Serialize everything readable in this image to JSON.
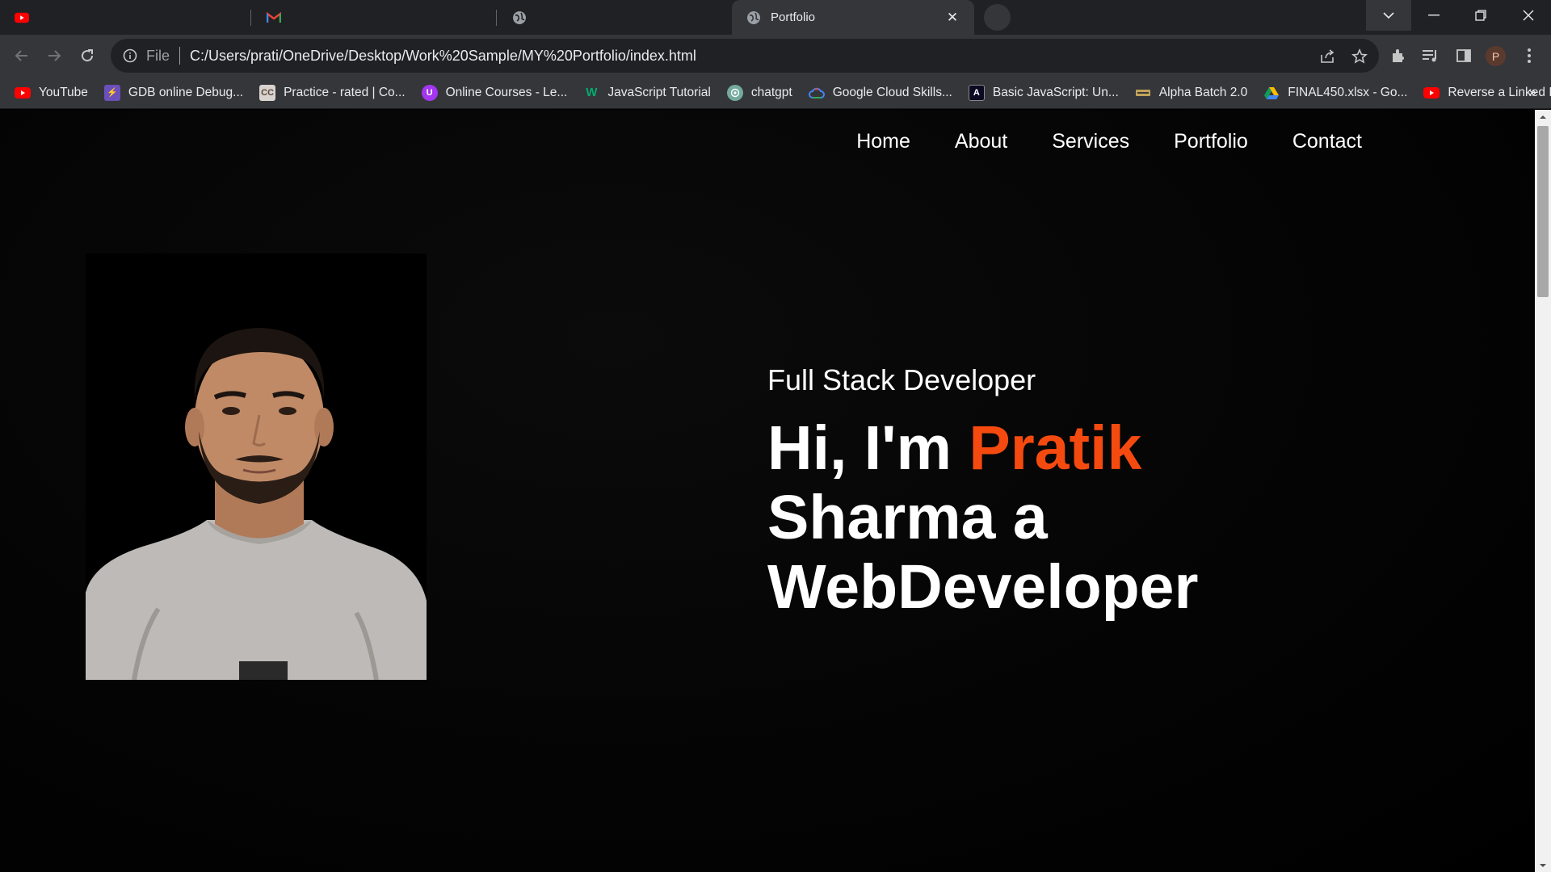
{
  "browser": {
    "tabs": [
      {
        "title": "",
        "icon": "youtube-icon"
      },
      {
        "title": "",
        "icon": "gmail-icon"
      },
      {
        "title": "",
        "icon": "globe-icon"
      },
      {
        "title": "Portfolio",
        "icon": "globe-icon",
        "active": true
      }
    ],
    "address": {
      "scheme_label": "File",
      "url": "C:/Users/prati/OneDrive/Desktop/Work%20Sample/MY%20Portfolio/index.html"
    },
    "profile_initial": "P",
    "bookmarks": [
      {
        "label": "YouTube",
        "icon": "youtube-icon",
        "color": "#ff0000"
      },
      {
        "label": "GDB online Debug...",
        "icon": "bolt-icon",
        "color": "#6b4fbb"
      },
      {
        "label": "Practice - rated | Co...",
        "icon": "codechef-icon",
        "color": "#5b4638"
      },
      {
        "label": "Online Courses - Le...",
        "icon": "udemy-icon",
        "color": "#a435f0"
      },
      {
        "label": "JavaScript Tutorial",
        "icon": "w3-icon",
        "color": "#04aa6d"
      },
      {
        "label": "chatgpt",
        "icon": "openai-icon",
        "color": "#74aa9c"
      },
      {
        "label": "Google Cloud Skills...",
        "icon": "gcloud-icon",
        "color": "#4285f4"
      },
      {
        "label": "Basic JavaScript: Un...",
        "icon": "fcc-icon",
        "color": "#0a0a23"
      },
      {
        "label": "Alpha Batch 2.0",
        "icon": "apna-icon",
        "color": "#c2a35a"
      },
      {
        "label": "FINAL450.xlsx - Go...",
        "icon": "gdrive-icon",
        "color": "#fbbc04"
      },
      {
        "label": "Reverse a Linked Lis...",
        "icon": "youtube-icon",
        "color": "#ff0000"
      }
    ],
    "bookmarks_more": "»"
  },
  "site": {
    "nav": [
      "Home",
      "About",
      "Services",
      "Portfolio",
      "Contact"
    ],
    "hero": {
      "subtitle": "Full Stack Developer",
      "greeting": "Hi, I'm ",
      "name": "Pratik",
      "line2": "Sharma a",
      "line3": "WebDeveloper"
    },
    "colors": {
      "accent": "#f54a0f",
      "background": "#000000",
      "text": "#ffffff"
    }
  }
}
